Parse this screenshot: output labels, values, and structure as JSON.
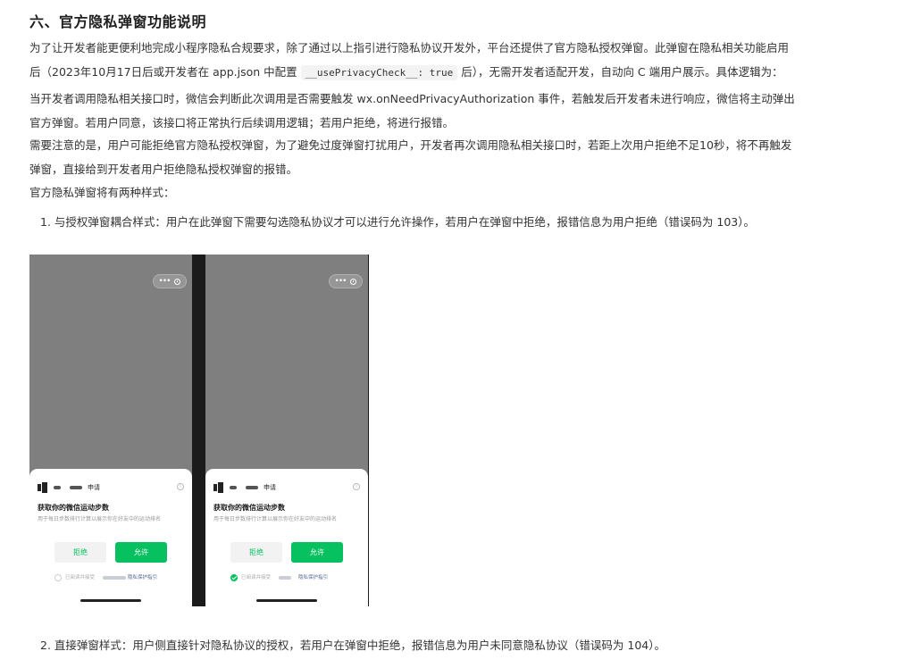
{
  "heading": "六、官方隐私弹窗功能说明",
  "p1": {
    "line1": "为了让开发者能更便利地完成小程序隐私合规要求，除了通过以上指引进行隐私协议开发外，平台还提供了官方隐私授权弹窗。此弹窗在隐私相关功能启用",
    "line2_pre": "后（2023年10月17日后或开发者在 app.json 中配置",
    "line2_code": "__usePrivacyCheck__: true",
    "line2_post": "后），无需开发者适配开发，自动向 C 端用户展示。具体逻辑为："
  },
  "p2": {
    "line1": "当开发者调用隐私相关接口时，微信会判断此次调用是否需要触发 wx.onNeedPrivacyAuthorization 事件，若触发后开发者未进行响应，微信将主动弹出",
    "line2": "官方弹窗。若用户同意，该接口将正常执行后续调用逻辑；若用户拒绝，将进行报错。"
  },
  "p3": {
    "line1": "需要注意的是，用户可能拒绝官方隐私授权弹窗，为了避免过度弹窗打扰用户，开发者再次调用隐私相关接口时，若距上次用户拒绝不足10秒，将不再触发",
    "line2": "弹窗，直接给到开发者用户拒绝隐私授权弹窗的报错。"
  },
  "p4": "官方隐私弹窗将有两种样式：",
  "list": [
    "1. 与授权弹窗耦合样式：用户在此弹窗下需要勾选隐私协议才可以进行允许操作，若用户在弹窗中拒绝，报错信息为用户拒绝（错误码为 103）。",
    "2. 直接弹窗样式：用户侧直接针对隐私协议的授权，若用户在弹窗中拒绝，报错信息为用户未同意隐私协议（错误码为 104）。"
  ],
  "mockup": {
    "apply_label": "申请",
    "title": "获取你的微信运动步数",
    "desc": "用于每日步数排行计算以展示你在好友中的运动排名",
    "deny": "拒绝",
    "allow": "允许",
    "agree_prefix": "已阅读并接受",
    "agree_link": "隐私保护指引",
    "left_checked": false,
    "right_checked": true,
    "accent": "#07c160"
  }
}
